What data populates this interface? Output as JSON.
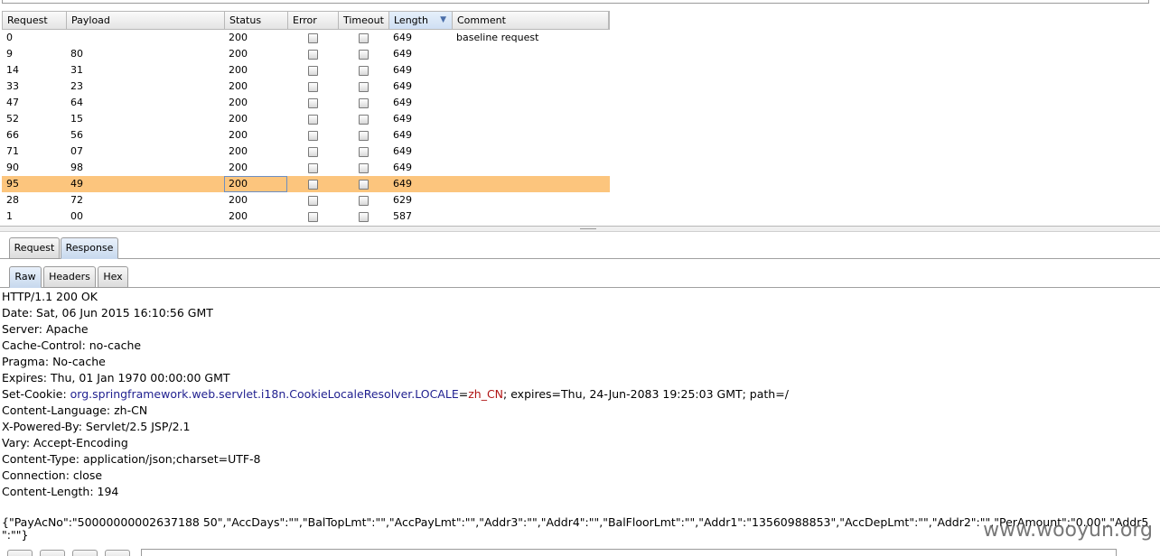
{
  "table": {
    "columns": [
      "Request",
      "Payload",
      "Status",
      "Error",
      "Timeout",
      "Length",
      "Comment"
    ],
    "rows": [
      {
        "request": "0",
        "payload": "",
        "status": "200",
        "length": "649",
        "comment": "baseline request"
      },
      {
        "request": "9",
        "payload": "80",
        "status": "200",
        "length": "649",
        "comment": ""
      },
      {
        "request": "14",
        "payload": "31",
        "status": "200",
        "length": "649",
        "comment": ""
      },
      {
        "request": "33",
        "payload": "23",
        "status": "200",
        "length": "649",
        "comment": ""
      },
      {
        "request": "47",
        "payload": "64",
        "status": "200",
        "length": "649",
        "comment": ""
      },
      {
        "request": "52",
        "payload": "15",
        "status": "200",
        "length": "649",
        "comment": ""
      },
      {
        "request": "66",
        "payload": "56",
        "status": "200",
        "length": "649",
        "comment": ""
      },
      {
        "request": "71",
        "payload": "07",
        "status": "200",
        "length": "649",
        "comment": ""
      },
      {
        "request": "90",
        "payload": "98",
        "status": "200",
        "length": "649",
        "comment": ""
      },
      {
        "request": "95",
        "payload": "49",
        "status": "200",
        "length": "649",
        "comment": ""
      },
      {
        "request": "28",
        "payload": "72",
        "status": "200",
        "length": "629",
        "comment": ""
      },
      {
        "request": "1",
        "payload": "00",
        "status": "200",
        "length": "587",
        "comment": ""
      }
    ],
    "selected_row": 9,
    "sorted_column": "Length",
    "selected_color": "#fcc57d"
  },
  "tabs": {
    "outer": [
      "Request",
      "Response"
    ],
    "outer_active": "Response",
    "inner": [
      "Raw",
      "Headers",
      "Hex"
    ],
    "inner_active": "Raw"
  },
  "response": {
    "status_line": "HTTP/1.1 200 OK",
    "headers": [
      "Date: Sat, 06 Jun 2015 16:10:56 GMT",
      "Server: Apache",
      "Cache-Control: no-cache",
      "Pragma: No-cache",
      "Expires: Thu, 01 Jan 1970 00:00:00 GMT"
    ],
    "set_cookie": {
      "prefix": "Set-Cookie: ",
      "name": "org.springframework.web.servlet.i18n.CookieLocaleResolver.LOCALE",
      "eq": "=",
      "value": "zh_CN",
      "suffix": "; expires=Thu, 24-Jun-2083 19:25:03 GMT; path=/"
    },
    "headers_after": [
      "Content-Language: zh-CN",
      "X-Powered-By: Servlet/2.5 JSP/2.1",
      "Vary: Accept-Encoding",
      "Content-Type: application/json;charset=UTF-8",
      "Connection: close",
      "Content-Length: 194"
    ],
    "body_line1": "{\"PayAcNo\":\"50000000002637188 50\",\"AccDays\":\"\",\"BalTopLmt\":\"\",\"AccPayLmt\":\"\",\"Addr3\":\"\",\"Addr4\":\"\",\"BalFloorLmt\":\"\",\"Addr1\":\"13560988853\",\"AccDepLmt\":\"\",\"Addr2\":\"\",\"PerAmount\":\"0.00\",\"Addr5",
    "body_line2": "\":\"\"}"
  },
  "watermark": "www.wooyun.org",
  "colors": {
    "keyword": "#1f1f8f",
    "value": "#b01414",
    "active_tab": "#c8d9ee"
  }
}
